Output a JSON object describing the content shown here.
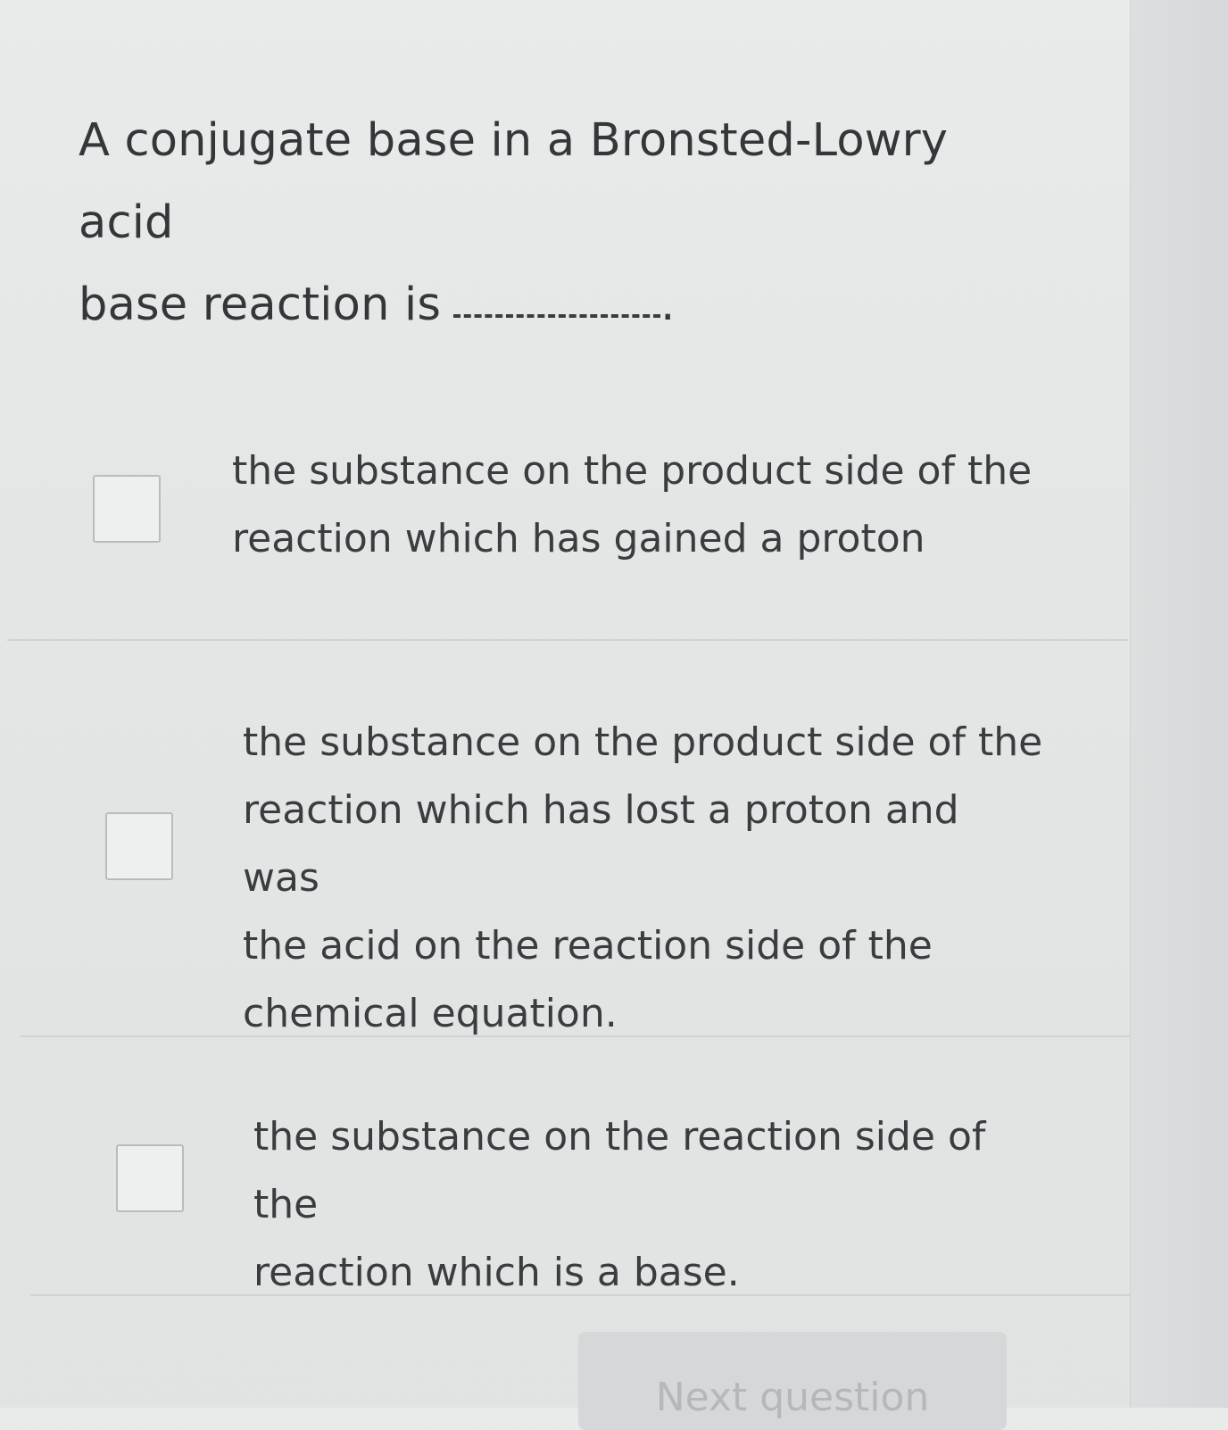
{
  "question": {
    "line1": "A conjugate base in a Bronsted-Lowry acid",
    "line2": "base reaction is",
    "end_punct": "."
  },
  "options": [
    {
      "lines": [
        "the substance on the product side of the",
        "reaction which has gained a proton"
      ],
      "checked": false
    },
    {
      "lines": [
        "the substance on the product side of the",
        "reaction which has lost a proton and was",
        "the acid on the reaction side of the",
        "chemical equation."
      ],
      "checked": false
    },
    {
      "lines": [
        "the substance on the reaction side of the",
        "reaction which is a base."
      ],
      "checked": false
    }
  ],
  "next_button": {
    "label": "Next question"
  }
}
